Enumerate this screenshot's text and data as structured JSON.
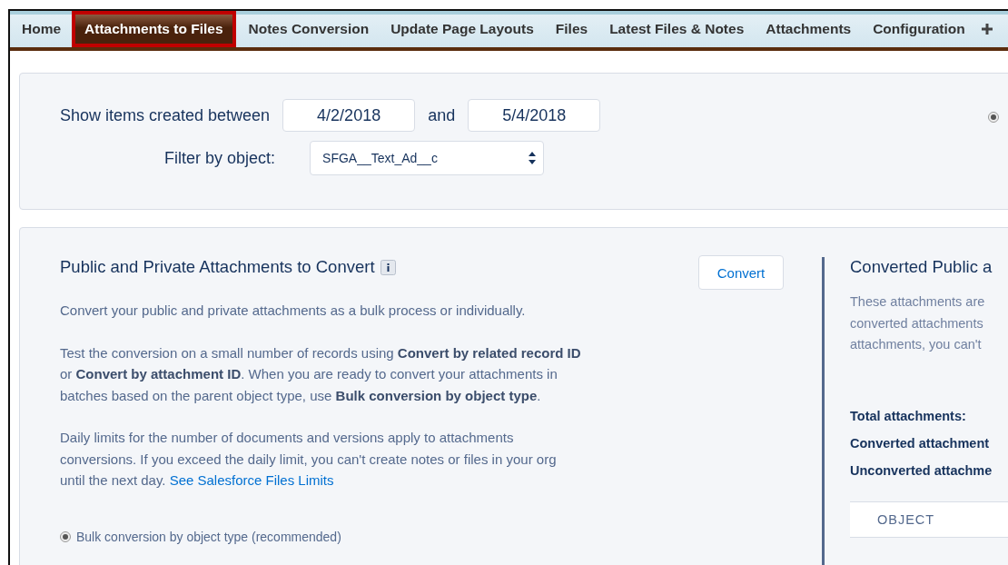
{
  "tabs": [
    {
      "label": "Home",
      "selected": false
    },
    {
      "label": "Attachments to Files",
      "selected": true
    },
    {
      "label": "Notes Conversion",
      "selected": false
    },
    {
      "label": "Update Page Layouts",
      "selected": false
    },
    {
      "label": "Files",
      "selected": false
    },
    {
      "label": "Latest Files & Notes",
      "selected": false
    },
    {
      "label": "Attachments",
      "selected": false
    },
    {
      "label": "Configuration",
      "selected": false
    }
  ],
  "filter": {
    "date_label": "Show items created between",
    "start_date": "4/2/2018",
    "and_label": "and",
    "end_date": "5/4/2018",
    "object_label": "Filter by object:",
    "object_value": "SFGA__Text_Ad__c",
    "radio_selected": true
  },
  "convert_section": {
    "title": "Public and Private Attachments to Convert",
    "button": "Convert",
    "paragraphs": [
      "Convert your public and private attachments as a bulk process or individually.",
      "Test the conversion on a small number of records using **Convert by related record ID** or **Convert by attachment ID**. When you are ready to convert your attachments in batches based on the parent object type, use **Bulk conversion by object type**."
    ],
    "limits_text": "Daily limits for the number of documents and versions apply to attachments conversions. If you exceed the daily limit, you can't create notes or files in your org until the next day.",
    "limits_link": "See Salesforce Files Limits",
    "options": [
      {
        "label": "Bulk conversion by object type (recommended)",
        "selected": true
      }
    ]
  },
  "converted_section": {
    "title": "Converted Public a",
    "description_lines": [
      "These attachments are",
      "converted attachments",
      "attachments, you can't"
    ],
    "stats": [
      "Total attachments:",
      "Converted attachment",
      "Unconverted attachme"
    ],
    "table": {
      "columns": [
        "OBJECT"
      ]
    }
  }
}
